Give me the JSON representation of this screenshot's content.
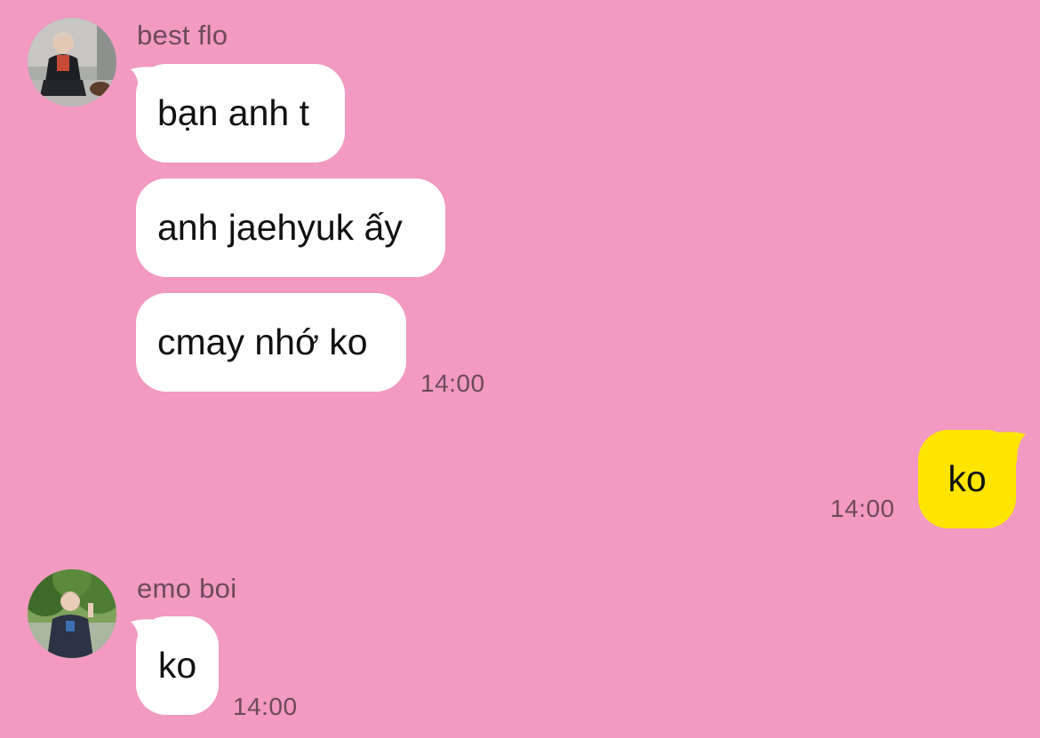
{
  "messages": [
    {
      "sender": "best flo",
      "bubbles": [
        "bạn anh t",
        "anh jaehyuk ấy",
        "cmay nhớ ko"
      ],
      "time": "14:00"
    },
    {
      "sender": "",
      "outgoing": true,
      "bubbles": [
        "ko"
      ],
      "time": "14:00"
    },
    {
      "sender": "emo boi",
      "bubbles": [
        "ko"
      ],
      "time": "14:00"
    }
  ],
  "colors": {
    "background": "#f29ac1",
    "incoming_bubble": "#ffffff",
    "outgoing_bubble": "#ffe500",
    "meta_text": "#6e4a58"
  }
}
